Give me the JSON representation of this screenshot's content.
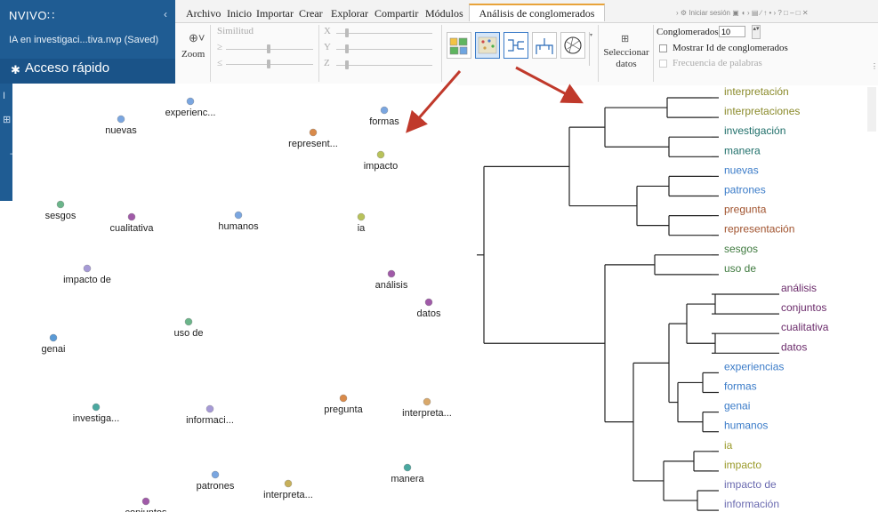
{
  "app": {
    "logo": "NVIVO",
    "logo_mark": "∷",
    "collapse_glyph": "‹",
    "project": "IA en investigaci...tiva.nvp (Saved)",
    "quick_access": "Acceso rápido",
    "quick_access_icon": "pin-icon"
  },
  "sidebar": {
    "partial_1": "I",
    "partial_2": "⊞",
    "partial_3": "-"
  },
  "ribbon": {
    "menu": [
      "Archivo",
      "Inicio",
      "Importar",
      "Crear",
      "Explorar",
      "Compartir",
      "Módulos"
    ],
    "active_tab": "Análisis de conglomerados",
    "window_controls": "› ⚙ Iniciar sesión ▣ ◖ › ▤ ∕ ↑ • › ? □ – □ ✕",
    "zoom_label": "Zoom",
    "zoom_icon": "zoom-icon",
    "zoom_glyph": "⊕˅",
    "similarity_label": "Similitud",
    "geq": "≥",
    "leq": "≤",
    "axes": [
      "X",
      "Y",
      "Z"
    ],
    "select_data_label": "Seleccionar datos",
    "select_data_glyph": "⊞",
    "clusters_label": "Conglomerados",
    "clusters_value": "10",
    "spin_glyph": "▴▾",
    "show_ids_label": "Mostrar Id de conglomerados",
    "word_freq_label": "Frecuencia de palabras",
    "more_glyph": "▾"
  },
  "colors": {
    "sidebar": "#1f5c93",
    "arrow": "#c0392b",
    "tab_accent": "#e8a33a"
  },
  "scatter": {
    "points": [
      {
        "label": "experienc...",
        "color": "#7aa6e0"
      },
      {
        "label": "formas",
        "color": "#7aa6e0"
      },
      {
        "label": "nuevas",
        "color": "#7aa6e0"
      },
      {
        "label": "represent...",
        "color": "#d98a4a"
      },
      {
        "label": "impacto",
        "color": "#b8c25a"
      },
      {
        "label": "sesgos",
        "color": "#6bb58a"
      },
      {
        "label": "cualitativa",
        "color": "#a05aa8"
      },
      {
        "label": "humanos",
        "color": "#7aa6e0"
      },
      {
        "label": "ia",
        "color": "#b8c25a"
      },
      {
        "label": "impacto de",
        "color": "#a69ad6"
      },
      {
        "label": "análisis",
        "color": "#a05aa8"
      },
      {
        "label": "datos",
        "color": "#a05aa8"
      },
      {
        "label": "uso de",
        "color": "#6bb58a"
      },
      {
        "label": "genai",
        "color": "#5a9ad6"
      },
      {
        "label": "investiga...",
        "color": "#4aa8a0"
      },
      {
        "label": "informaci...",
        "color": "#a69ad6"
      },
      {
        "label": "pregunta",
        "color": "#d98a4a"
      },
      {
        "label": "interpreta...",
        "color": "#d9a86a"
      },
      {
        "label": "manera",
        "color": "#4aa8a0"
      },
      {
        "label": "patrones",
        "color": "#7aa6e0"
      },
      {
        "label": "interpreta...",
        "color": "#c7b05a"
      },
      {
        "label": "conjuntos",
        "color": "#a05aa8"
      }
    ]
  },
  "dendrogram": {
    "leaves": [
      {
        "label": "interpretación",
        "color": "#8a8a2a"
      },
      {
        "label": "interpretaciones",
        "color": "#8a8a2a"
      },
      {
        "label": "investigación",
        "color": "#1f6f6a"
      },
      {
        "label": "manera",
        "color": "#1f6f6a"
      },
      {
        "label": "nuevas",
        "color": "#3a7bc8"
      },
      {
        "label": "patrones",
        "color": "#3a7bc8"
      },
      {
        "label": "pregunta",
        "color": "#a0522d"
      },
      {
        "label": "representación",
        "color": "#a0522d"
      },
      {
        "label": "sesgos",
        "color": "#3f7a3f"
      },
      {
        "label": "uso de",
        "color": "#3f7a3f"
      },
      {
        "label": "análisis",
        "color": "#6a2a6a"
      },
      {
        "label": "conjuntos",
        "color": "#6a2a6a"
      },
      {
        "label": "cualitativa",
        "color": "#6a2a6a"
      },
      {
        "label": "datos",
        "color": "#6a2a6a"
      },
      {
        "label": "experiencias",
        "color": "#3a7bc8"
      },
      {
        "label": "formas",
        "color": "#3a7bc8"
      },
      {
        "label": "genai",
        "color": "#3a7bc8"
      },
      {
        "label": "humanos",
        "color": "#3a7bc8"
      },
      {
        "label": "ia",
        "color": "#9a9a2a"
      },
      {
        "label": "impacto",
        "color": "#9a9a2a"
      },
      {
        "label": "impacto de",
        "color": "#6a6ab0"
      },
      {
        "label": "información",
        "color": "#6a6ab0"
      }
    ]
  }
}
